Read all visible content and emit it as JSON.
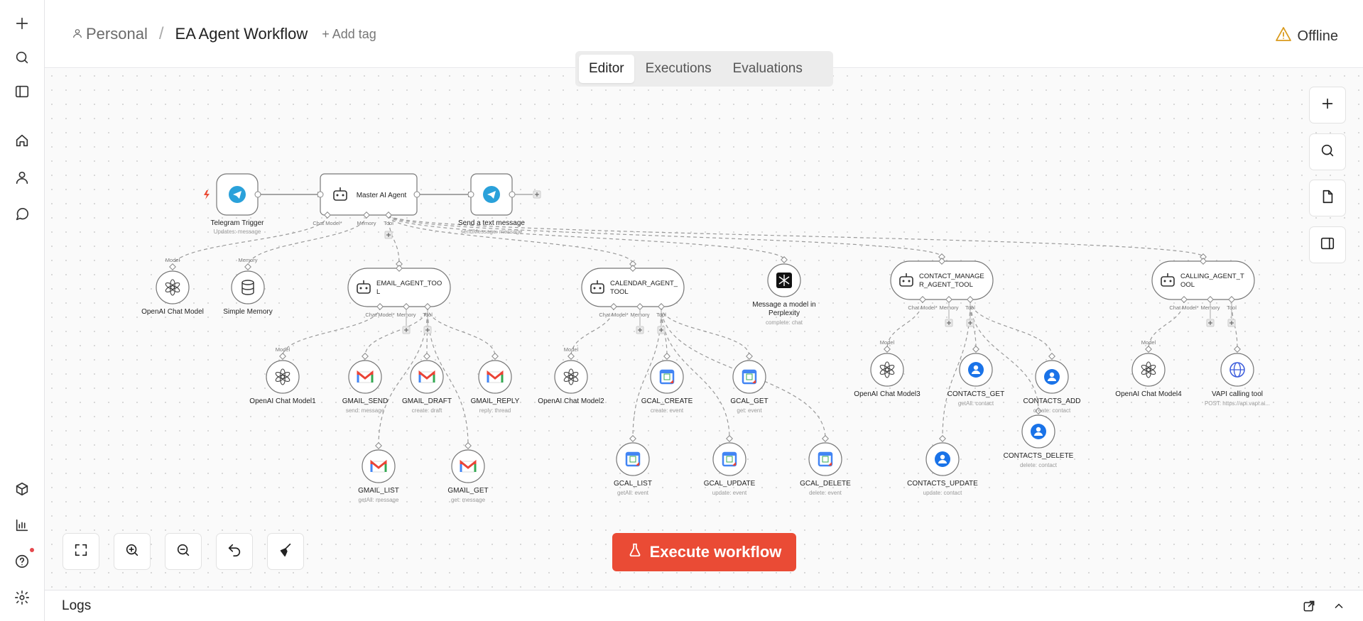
{
  "header": {
    "project": "Personal",
    "separator": "/",
    "workflow_name": "EA Agent Workflow",
    "add_tag": "+ Add tag",
    "status": "Offline"
  },
  "tabs": [
    "Editor",
    "Executions",
    "Evaluations"
  ],
  "execute_label": "Execute workflow",
  "logs_label": "Logs",
  "colors": {
    "accent": "#ea4b35",
    "warning": "#d99a1c",
    "telegram": "#2aa1da",
    "gcal": "#4285f4",
    "contacts": "#1a73e8"
  },
  "sidebar_icons": [
    "plus-icon",
    "search-icon",
    "panel-icon",
    "home-icon",
    "user-icon",
    "chat-icon",
    "cube-icon",
    "chart-icon",
    "help-icon",
    "gear-icon"
  ],
  "workflow": {
    "nodes": [
      {
        "id": "telegram-trigger",
        "kind": "trigger",
        "icon": "telegram",
        "label": "Telegram Trigger",
        "sub": "Updates: message"
      },
      {
        "id": "master-agent",
        "kind": "agent",
        "label": "Master AI Agent",
        "ports": [
          "Chat Model*",
          "Memory",
          "Tool"
        ]
      },
      {
        "id": "send-text",
        "kind": "action",
        "icon": "telegram",
        "label": "Send a text message",
        "sub": "sendMessage: message"
      },
      {
        "id": "openai-chat-model",
        "kind": "sub",
        "icon": "openai",
        "label": "OpenAI Chat Model",
        "in": "Model"
      },
      {
        "id": "simple-memory",
        "kind": "sub",
        "icon": "db",
        "label": "Simple Memory",
        "in": "Memory"
      },
      {
        "id": "email-agent",
        "kind": "agenttool",
        "label": "EMAIL_AGENT_TOO|L",
        "ports": [
          "Chat Model*",
          "Memory",
          "Tool"
        ]
      },
      {
        "id": "calendar-agent",
        "kind": "agenttool",
        "label": "CALENDAR_AGENT_|TOOL",
        "ports": [
          "Chat Model*",
          "Memory",
          "Tool"
        ]
      },
      {
        "id": "perplexity",
        "kind": "sub",
        "icon": "perplexity",
        "label": "Message a model in|Perplexity",
        "sub": "complete: chat"
      },
      {
        "id": "contact-agent",
        "kind": "agenttool",
        "label": "CONTACT_MANAGE|R_AGENT_TOOL",
        "ports": [
          "Chat Model*",
          "Memory",
          "Tool"
        ]
      },
      {
        "id": "calling-agent",
        "kind": "agenttool",
        "label": "CALLING_AGENT_T|OOL",
        "ports": [
          "Chat Model*",
          "Memory",
          "Tool"
        ]
      },
      {
        "id": "openai-1",
        "kind": "sub",
        "icon": "openai",
        "label": "OpenAI Chat Model1",
        "in": "Model"
      },
      {
        "id": "gmail-send",
        "kind": "sub",
        "icon": "gmail",
        "label": "GMAIL_SEND",
        "sub": "send: message"
      },
      {
        "id": "gmail-draft",
        "kind": "sub",
        "icon": "gmail",
        "label": "GMAIL_DRAFT",
        "sub": "create: draft"
      },
      {
        "id": "gmail-reply",
        "kind": "sub",
        "icon": "gmail",
        "label": "GMAIL_REPLY",
        "sub": "reply: thread"
      },
      {
        "id": "gmail-list",
        "kind": "sub",
        "icon": "gmail",
        "label": "GMAIL_LIST",
        "sub": "getAll: message"
      },
      {
        "id": "gmail-get",
        "kind": "sub",
        "icon": "gmail",
        "label": "GMAIL_GET",
        "sub": "get: message"
      },
      {
        "id": "openai-2",
        "kind": "sub",
        "icon": "openai",
        "label": "OpenAI Chat Model2",
        "in": "Model"
      },
      {
        "id": "gcal-create",
        "kind": "sub",
        "icon": "gcal",
        "label": "GCAL_CREATE",
        "sub": "create: event"
      },
      {
        "id": "gcal-get",
        "kind": "sub",
        "icon": "gcal",
        "label": "GCAL_GET",
        "sub": "get: event"
      },
      {
        "id": "gcal-list",
        "kind": "sub",
        "icon": "gcal",
        "label": "GCAL_LIST",
        "sub": "getAll: event"
      },
      {
        "id": "gcal-update",
        "kind": "sub",
        "icon": "gcal",
        "label": "GCAL_UPDATE",
        "sub": "update: event"
      },
      {
        "id": "gcal-delete",
        "kind": "sub",
        "icon": "gcal",
        "label": "GCAL_DELETE",
        "sub": "delete: event"
      },
      {
        "id": "openai-3",
        "kind": "sub",
        "icon": "openai",
        "label": "OpenAI Chat Model3",
        "in": "Model"
      },
      {
        "id": "contacts-get",
        "kind": "sub",
        "icon": "contacts",
        "label": "CONTACTS_GET",
        "sub": "getAll: contact"
      },
      {
        "id": "contacts-add",
        "kind": "sub",
        "icon": "contacts",
        "label": "CONTACTS_ADD",
        "sub": "create: contact"
      },
      {
        "id": "contacts-delete",
        "kind": "sub",
        "icon": "contacts",
        "label": "CONTACTS_DELETE",
        "sub": "delete: contact"
      },
      {
        "id": "contacts-update",
        "kind": "sub",
        "icon": "contacts",
        "label": "CONTACTS_UPDATE",
        "sub": "update: contact"
      },
      {
        "id": "openai-4",
        "kind": "sub",
        "icon": "openai",
        "label": "OpenAI Chat Model4",
        "in": "Model"
      },
      {
        "id": "vapi",
        "kind": "sub",
        "icon": "globe",
        "label": "VAPI calling tool",
        "sub": "POST: https://api.vapi.ai..."
      }
    ],
    "main_connections": [
      [
        "telegram-trigger",
        "master-agent"
      ],
      [
        "master-agent",
        "send-text"
      ]
    ],
    "sub_connections": [
      [
        "openai-chat-model",
        "master-agent",
        0
      ],
      [
        "simple-memory",
        "master-agent",
        1
      ],
      [
        "email-agent",
        "master-agent",
        2
      ],
      [
        "calendar-agent",
        "master-agent",
        2
      ],
      [
        "perplexity",
        "master-agent",
        2
      ],
      [
        "contact-agent",
        "master-agent",
        2
      ],
      [
        "calling-agent",
        "master-agent",
        2
      ],
      [
        "openai-1",
        "email-agent",
        0
      ],
      [
        "gmail-send",
        "email-agent",
        2
      ],
      [
        "gmail-draft",
        "email-agent",
        2
      ],
      [
        "gmail-reply",
        "email-agent",
        2
      ],
      [
        "gmail-list",
        "email-agent",
        2
      ],
      [
        "gmail-get",
        "email-agent",
        2
      ],
      [
        "openai-2",
        "calendar-agent",
        0
      ],
      [
        "gcal-create",
        "calendar-agent",
        2
      ],
      [
        "gcal-get",
        "calendar-agent",
        2
      ],
      [
        "gcal-list",
        "calendar-agent",
        2
      ],
      [
        "gcal-update",
        "calendar-agent",
        2
      ],
      [
        "gcal-delete",
        "calendar-agent",
        2
      ],
      [
        "openai-3",
        "contact-agent",
        0
      ],
      [
        "contacts-get",
        "contact-agent",
        2
      ],
      [
        "contacts-add",
        "contact-agent",
        2
      ],
      [
        "contacts-delete",
        "contact-agent",
        2
      ],
      [
        "contacts-update",
        "contact-agent",
        2
      ],
      [
        "openai-4",
        "calling-agent",
        0
      ],
      [
        "vapi",
        "calling-agent",
        2
      ]
    ],
    "memory_plus_nodes": [
      "email-agent",
      "calendar-agent",
      "contact-agent",
      "calling-agent"
    ]
  }
}
